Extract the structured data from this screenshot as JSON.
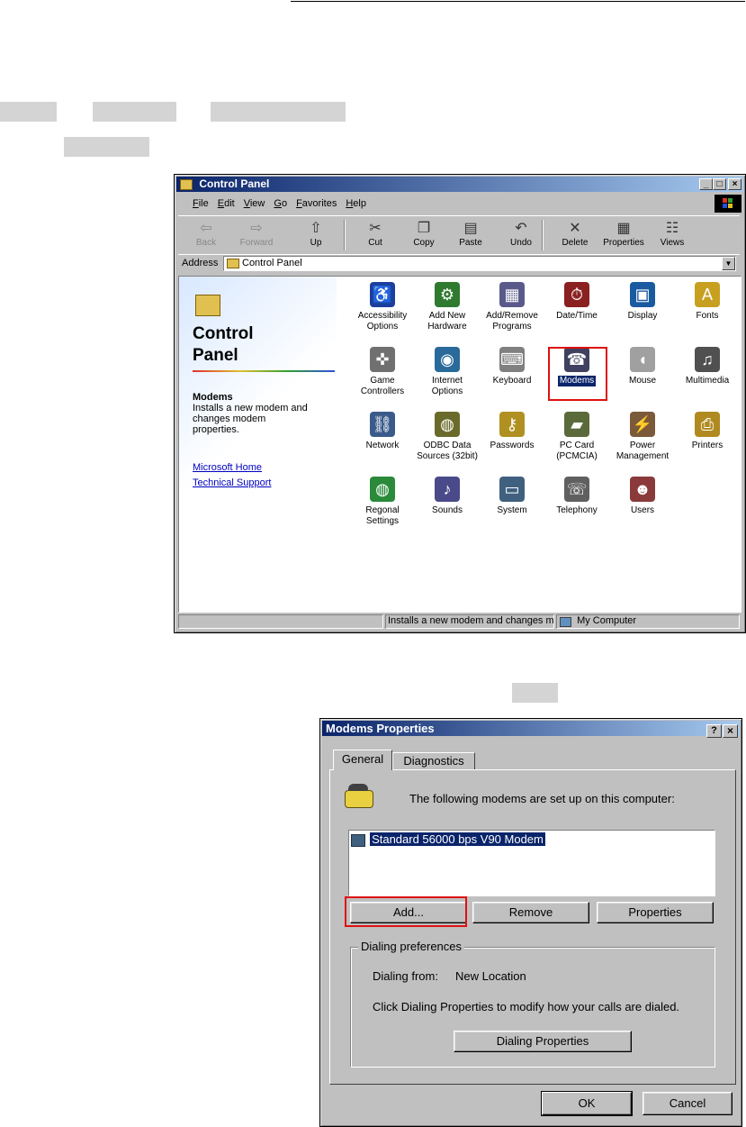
{
  "control_panel": {
    "title": "Control Panel",
    "menu": [
      "File",
      "Edit",
      "View",
      "Go",
      "Favorites",
      "Help"
    ],
    "toolbar": [
      {
        "label": "Back",
        "icon": "back-arrow-icon",
        "glyph": "⇦",
        "enabled": false
      },
      {
        "label": "Forward",
        "icon": "forward-arrow-icon",
        "glyph": "⇨",
        "enabled": false
      },
      {
        "label": "Up",
        "icon": "up-folder-icon",
        "glyph": "⇧",
        "enabled": true
      },
      {
        "label": "Cut",
        "icon": "scissors-icon",
        "glyph": "✂",
        "enabled": true
      },
      {
        "label": "Copy",
        "icon": "copy-icon",
        "glyph": "❐",
        "enabled": true
      },
      {
        "label": "Paste",
        "icon": "paste-icon",
        "glyph": "▤",
        "enabled": true
      },
      {
        "label": "Undo",
        "icon": "undo-icon",
        "glyph": "↶",
        "enabled": true
      },
      {
        "label": "Delete",
        "icon": "delete-x-icon",
        "glyph": "✕",
        "enabled": true
      },
      {
        "label": "Properties",
        "icon": "properties-icon",
        "glyph": "▦",
        "enabled": true
      },
      {
        "label": "Views",
        "icon": "views-icon",
        "glyph": "☷",
        "enabled": true
      }
    ],
    "address_label": "Address",
    "address_value": "Control Panel",
    "left_panel": {
      "heading_line1": "Control",
      "heading_line2": "Panel",
      "selected_name": "Modems",
      "selected_desc": "Installs a new modem and changes modem properties.",
      "links": [
        "Microsoft Home",
        "Technical Support"
      ]
    },
    "icons": [
      {
        "label": "Accessibility\nOptions",
        "icon": "accessibility-icon",
        "glyph": "♿",
        "color": "#1c3f9e"
      },
      {
        "label": "Add New\nHardware",
        "icon": "add-hardware-icon",
        "glyph": "⚙",
        "color": "#2f7a2f"
      },
      {
        "label": "Add/Remove\nPrograms",
        "icon": "add-remove-programs-icon",
        "glyph": "▦",
        "color": "#5a5a8a"
      },
      {
        "label": "Date/Time",
        "icon": "date-time-icon",
        "glyph": "⏱",
        "color": "#8a2020"
      },
      {
        "label": "Display",
        "icon": "display-icon",
        "glyph": "▣",
        "color": "#1a5aa0"
      },
      {
        "label": "Fonts",
        "icon": "fonts-icon",
        "glyph": "A",
        "color": "#c8a020"
      },
      {
        "label": "Game\nControllers",
        "icon": "game-controller-icon",
        "glyph": "✜",
        "color": "#707070"
      },
      {
        "label": "Internet\nOptions",
        "icon": "internet-options-icon",
        "glyph": "◉",
        "color": "#2a6a9a"
      },
      {
        "label": "Keyboard",
        "icon": "keyboard-icon",
        "glyph": "⌨",
        "color": "#808080"
      },
      {
        "label": "Modems",
        "icon": "modem-phone-icon",
        "glyph": "☎",
        "color": "#404060"
      },
      {
        "label": "Mouse",
        "icon": "mouse-icon",
        "glyph": "◖",
        "color": "#a0a0a0"
      },
      {
        "label": "Multimedia",
        "icon": "multimedia-icon",
        "glyph": "♫",
        "color": "#505050"
      },
      {
        "label": "Network",
        "icon": "network-icon",
        "glyph": "⛓",
        "color": "#3a5a8a"
      },
      {
        "label": "ODBC Data\nSources (32bit)",
        "icon": "odbc-icon",
        "glyph": "◍",
        "color": "#6a6a2a"
      },
      {
        "label": "Passwords",
        "icon": "passwords-key-icon",
        "glyph": "⚷",
        "color": "#b09020"
      },
      {
        "label": "PC Card\n(PCMCIA)",
        "icon": "pc-card-icon",
        "glyph": "▰",
        "color": "#5a6a3a"
      },
      {
        "label": "Power\nManagement",
        "icon": "power-management-icon",
        "glyph": "⚡",
        "color": "#7a5a3a"
      },
      {
        "label": "Printers",
        "icon": "printers-icon",
        "glyph": "⎙",
        "color": "#b08a20"
      },
      {
        "label": "Regonal\nSettings",
        "icon": "regional-globe-icon",
        "glyph": "◍",
        "color": "#2a8a3a"
      },
      {
        "label": "Sounds",
        "icon": "sounds-icon",
        "glyph": "♪",
        "color": "#4a4a8a"
      },
      {
        "label": "System",
        "icon": "system-computer-icon",
        "glyph": "▭",
        "color": "#406080"
      },
      {
        "label": "Telephony",
        "icon": "telephony-icon",
        "glyph": "☏",
        "color": "#606060"
      },
      {
        "label": "Users",
        "icon": "users-icon",
        "glyph": "☻",
        "color": "#8a3a3a"
      }
    ],
    "status_text": "Installs a new modem and changes mod",
    "status_location": "My Computer"
  },
  "modems_dialog": {
    "title": "Modems Properties",
    "tabs": [
      "General",
      "Diagnostics"
    ],
    "intro": "The following modems are set up on this computer:",
    "modems": [
      "Standard 56000 bps V90 Modem"
    ],
    "buttons": {
      "add": "Add...",
      "remove": "Remove",
      "properties": "Properties"
    },
    "group_label": "Dialing preferences",
    "dialing_from_label": "Dialing from:",
    "dialing_from_value": "New Location",
    "dialing_hint": "Click Dialing Properties to modify how your calls are dialed.",
    "dialing_properties_button": "Dialing Properties",
    "ok": "OK",
    "cancel": "Cancel"
  }
}
